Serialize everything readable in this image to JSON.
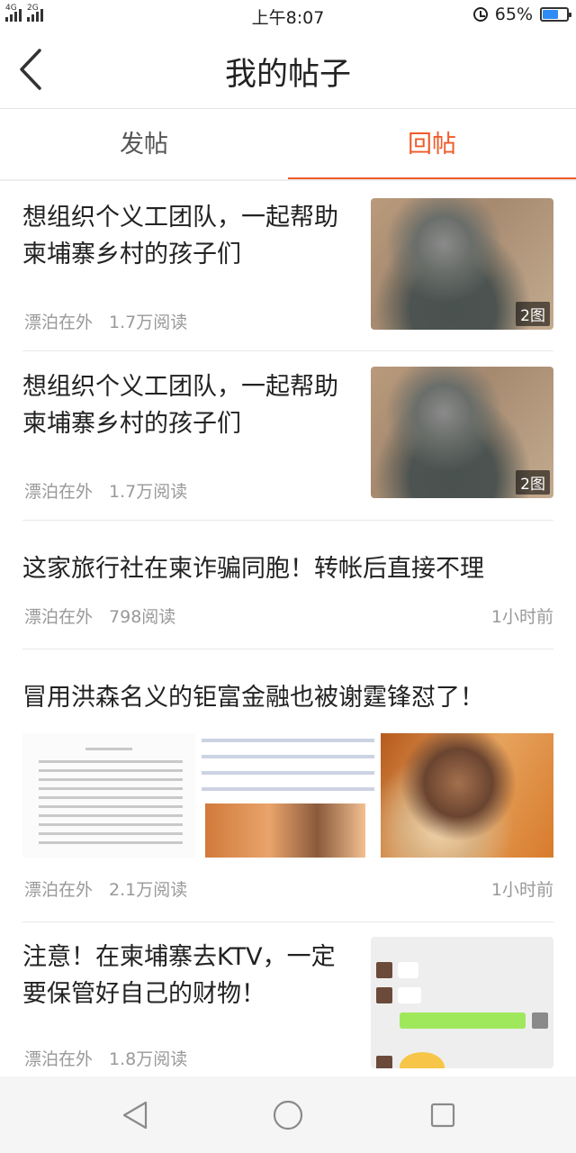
{
  "status_bar": {
    "network1": "4G",
    "network2": "2G",
    "time": "上午8:07",
    "battery": "65%",
    "battery_level": 0.65,
    "battery_color": "#2f8cf5"
  },
  "header": {
    "title": "我的帖子",
    "back_icon": "chevron-left-icon"
  },
  "tabs": [
    {
      "label": "发帖",
      "active": false
    },
    {
      "label": "回帖",
      "active": true
    }
  ],
  "accent_color": "#f05a28",
  "posts": [
    {
      "title": "想组织个义工团队，一起帮助柬埔寨乡村的孩子们",
      "author": "漂泊在外",
      "reads": "1.7万阅读",
      "badge": "2图"
    },
    {
      "title": "想组织个义工团队，一起帮助柬埔寨乡村的孩子们",
      "author": "漂泊在外",
      "reads": "1.7万阅读",
      "badge": "2图"
    },
    {
      "title": "这家旅行社在柬诈骗同胞！转帐后直接不理",
      "author": "漂泊在外",
      "reads": "798阅读",
      "time": "1小时前"
    },
    {
      "title": "冒用洪森名义的钜富金融也被谢霆锋怼了！",
      "author": "漂泊在外",
      "reads": "2.1万阅读",
      "time": "1小时前"
    },
    {
      "title": "注意！在柬埔寨去KTV，一定要保管好自己的财物！",
      "author": "漂泊在外",
      "reads": "1.8万阅读"
    }
  ],
  "nav": [
    "back-triangle-icon",
    "home-circle-icon",
    "recents-square-icon"
  ]
}
